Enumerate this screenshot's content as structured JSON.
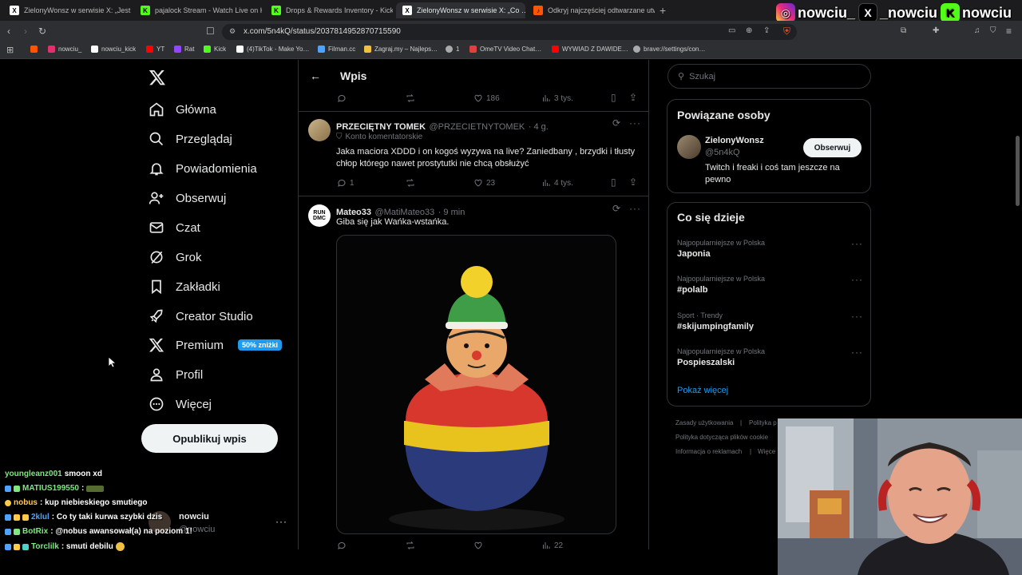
{
  "browser": {
    "tabs": [
      {
        "title": "ZielonyWonsz w serwisie X: „Jest jes…",
        "favicon": "x-icon",
        "color": "#ffffff"
      },
      {
        "title": "pajalock Stream - Watch Live on Kick",
        "favicon": "kick-icon",
        "color": "#53fc18"
      },
      {
        "title": "Drops & Rewards Inventory - Kick St…",
        "favicon": "kick-icon",
        "color": "#53fc18"
      },
      {
        "title": "ZielonyWonsz w serwisie X: „Co …",
        "favicon": "x-icon",
        "color": "#ffffff",
        "active": true
      },
      {
        "title": "Odkryj najczęściej odtwarzane utwo…",
        "favicon": "music-icon",
        "color": "#ff5500"
      }
    ],
    "url": "x.com/5n4kQ/status/2037814952870715590",
    "bookmarks": [
      {
        "label": "",
        "color": "#ff5500"
      },
      {
        "label": "nowciu_",
        "color": "#e1306c"
      },
      {
        "label": "nowciu_kick",
        "color": "#ffffff"
      },
      {
        "label": "YT",
        "color": "#ff0000"
      },
      {
        "label": "Rat",
        "color": "#9146ff"
      },
      {
        "label": "Kick",
        "color": "#53fc18"
      },
      {
        "label": "(4)TikTok - Make Yo…",
        "color": "#ffffff"
      },
      {
        "label": "Filman.cc",
        "color": "#4fa3ff"
      },
      {
        "label": "Zagraj.my – Najleps…",
        "color": "#f0c040"
      },
      {
        "label": "1",
        "color": "#aaaaaa"
      },
      {
        "label": "OmeTV Video Chat…",
        "color": "#e04040"
      },
      {
        "label": "WYWIAD Z DAWIDE…",
        "color": "#ff0000"
      },
      {
        "label": "brave://settings/con…",
        "color": "#aaaaaa"
      }
    ]
  },
  "overlay": {
    "socials": [
      {
        "icon": "instagram-icon",
        "handle": "nowciu_",
        "color": "#d6249f"
      },
      {
        "icon": "x-icon",
        "handle": "_nowciu",
        "color": "#000000"
      },
      {
        "icon": "kick-icon",
        "handle": "nowciu",
        "color": "#53fc18"
      }
    ],
    "chat": [
      {
        "user": "youngleanz001",
        "msg": "smoon xd",
        "color": "#7fe87f"
      },
      {
        "user": "MATIUS199550",
        "msg": ":",
        "color": "#7fe87f"
      },
      {
        "user": "nobus",
        "msg": ": kup niebieskiego smutiego",
        "color": "#ffc94a"
      },
      {
        "user": "2klul",
        "msg": ": Co ty taki kurwa szybki dzis",
        "color": "#4fa3ff"
      },
      {
        "user": "BotRix",
        "msg": ": @nobus awansował(a) na poziom 1!",
        "color": "#7fe87f"
      },
      {
        "user": "Torclilk",
        "msg": ": smuti debilu",
        "color": "#7fe87f"
      }
    ]
  },
  "nav": {
    "items": [
      {
        "label": "Główna",
        "icon": "home-icon"
      },
      {
        "label": "Przeglądaj",
        "icon": "search-icon"
      },
      {
        "label": "Powiadomienia",
        "icon": "bell-icon"
      },
      {
        "label": "Obserwuj",
        "icon": "follow-icon"
      },
      {
        "label": "Czat",
        "icon": "mail-icon"
      },
      {
        "label": "Grok",
        "icon": "grok-icon"
      },
      {
        "label": "Zakładki",
        "icon": "bookmark-icon"
      },
      {
        "label": "Creator Studio",
        "icon": "rocket-icon"
      },
      {
        "label": "Premium",
        "icon": "x-icon"
      },
      {
        "label": "Profil",
        "icon": "person-icon"
      },
      {
        "label": "Więcej",
        "icon": "more-circle-icon"
      }
    ],
    "premium_badge": "50% zniżki",
    "post_button": "Opublikuj wpis",
    "account": {
      "name": "nowciu",
      "handle": "@nowciu"
    }
  },
  "main": {
    "header": "Wpis",
    "top_actions": {
      "likes": "186",
      "views": "3 tys."
    },
    "replies": [
      {
        "name": "PRZECIĘTNY TOMEK",
        "handle": "@PRZECIETNYTOMEK",
        "time": "· 4 g.",
        "badge": "Konto komentatorskie",
        "text": "Jaka maciora XDDD i on kogoś wyzywa na live? Zaniedbany , brzydki i tłusty chłop którego nawet prostytutki nie chcą obsłużyć",
        "replies": "1",
        "likes": "23",
        "views": "4 tys."
      },
      {
        "name": "Mateo33",
        "handle": "@MatiMateo33",
        "time": "· 9 min",
        "avatar_text": "RUN DMC",
        "text": "Giba się jak Wańka-wstańka.",
        "views": "22"
      }
    ]
  },
  "sidebar": {
    "search_placeholder": "Szukaj",
    "related_title": "Powiązane osoby",
    "related_user": {
      "name": "ZielonyWonsz",
      "handle": "@5n4kQ",
      "bio": "Twitch i freaki i coś tam jeszcze na pewno",
      "follow": "Obserwuj"
    },
    "trends_title": "Co się dzieje",
    "trends": [
      {
        "category": "Najpopularniejsze w Polska",
        "name": "Japonia"
      },
      {
        "category": "Najpopularniejsze w Polska",
        "name": "#polalb"
      },
      {
        "category": "Sport · Trendy",
        "name": "#skijumpingfamily"
      },
      {
        "category": "Najpopularniejsze w Polska",
        "name": "Pospieszalski"
      }
    ],
    "show_more": "Pokaż więcej",
    "footer": [
      "Zasady użytkowania",
      "|",
      "Polityka p",
      "Polityka dotycząca plików cookie",
      "Informacja o reklamach",
      "|",
      "Więce"
    ]
  },
  "colors": {
    "accent": "#1d9bf0",
    "background": "#000000",
    "border": "#2f3336",
    "muted": "#71767b"
  }
}
